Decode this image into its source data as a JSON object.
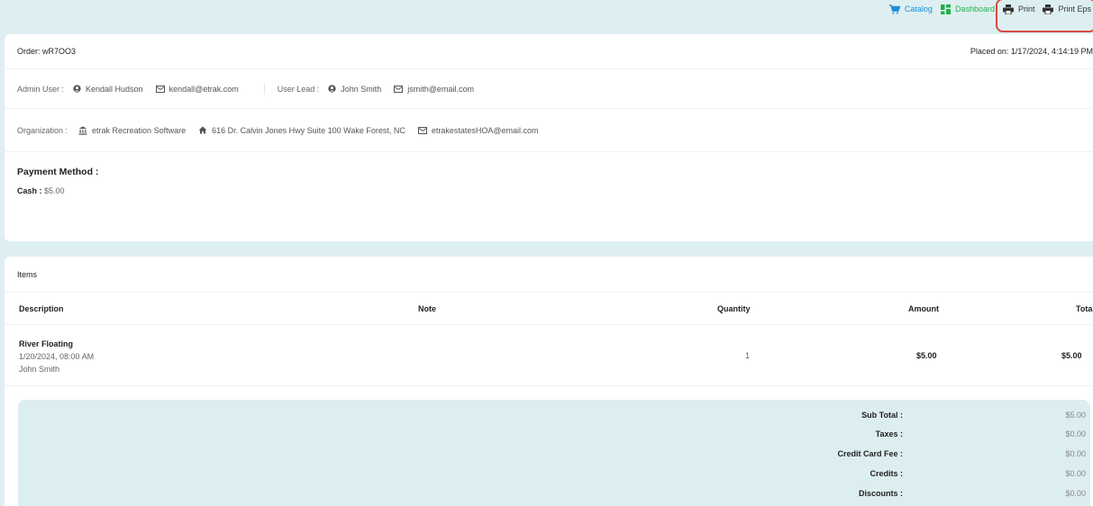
{
  "topbar": {
    "catalog": "Catalog",
    "dashboard": "Dashboard",
    "print": "Print",
    "print_eps": "Print Eps"
  },
  "order": {
    "label": "Order: wR7OO3",
    "placed": "Placed on: 1/17/2024, 4:14:19 PM"
  },
  "admin": {
    "label": "Admin User :",
    "name": "Kendall Hudson",
    "email": "kendall@etrak.com"
  },
  "lead": {
    "label": "User Lead :",
    "name": "John Smith",
    "email": "jsmith@email.com"
  },
  "organization": {
    "label": "Organization :",
    "name": "etrak Recreation Software",
    "address": "616 Dr. Calvin Jones Hwy Suite 100 Wake Forest, NC",
    "email": "etrakestatesHOA@email.com"
  },
  "payment": {
    "title": "Payment Method :",
    "method": "Cash :",
    "amount": "$5.00"
  },
  "items": {
    "title": "Items",
    "headers": {
      "description": "Description",
      "note": "Note",
      "quantity": "Quantity",
      "amount": "Amount",
      "total": "Total"
    },
    "rows": [
      {
        "name": "River Floating",
        "datetime": "1/20/2024, 08:00 AM",
        "person": "John Smith",
        "note": "",
        "quantity": "1",
        "amount": "$5.00",
        "total": "$5.00"
      }
    ]
  },
  "summary": {
    "subtotal_label": "Sub Total :",
    "subtotal": "$5.00",
    "taxes_label": "Taxes :",
    "taxes": "$0.00",
    "ccfee_label": "Credit Card Fee :",
    "ccfee": "$0.00",
    "credits_label": "Credits :",
    "credits": "$0.00",
    "discounts_label": "Discounts :",
    "discounts": "$0.00"
  },
  "colors": {
    "catalog": "#1a8fd8",
    "dashboard": "#22b04b",
    "highlight": "#d6493f",
    "background": "#deeff2"
  }
}
